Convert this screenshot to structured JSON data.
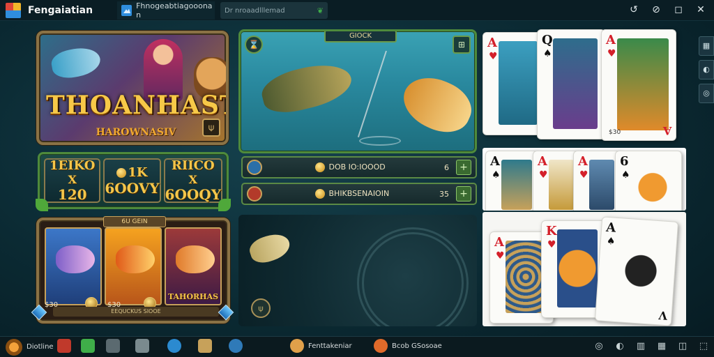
{
  "window": {
    "app_title": "Fengaiatian",
    "tab_label": "Fhnogeabtiagooona n",
    "tab_search_text": "Dr nroaadlllemad",
    "controls": [
      "↺",
      "⊘",
      "◻",
      "✕"
    ]
  },
  "banner": {
    "title": "THOANHAST",
    "subtitle": "HAROWNASIV",
    "corner_icon": "⍦"
  },
  "stats": [
    {
      "top": "1EIKO",
      "mid": "X",
      "bot": "120"
    },
    {
      "top": "1K",
      "mid": "",
      "bot": "6OOVY"
    },
    {
      "top": "RIICO",
      "mid": "X",
      "bot": "6OOQY"
    }
  ],
  "fish_cards": {
    "header": "6U GEIN",
    "cards": [
      {
        "label": ""
      },
      {
        "label": ""
      },
      {
        "label": "TAHORHAS"
      }
    ],
    "prices": [
      "$30",
      "$30"
    ],
    "footer": "EEQUCKUS SIOOE"
  },
  "scene": {
    "badge": "GIOCK",
    "btn_left": "⌛",
    "btn_right": "⊞"
  },
  "bars": [
    {
      "text": "DOB IO:IOOOD",
      "num": "6",
      "plus": "+"
    },
    {
      "text": "BHIKBSENAIOIN",
      "num": "35",
      "plus": "+"
    }
  ],
  "dark_panel": {
    "btn": "⍦"
  },
  "cards_top": [
    {
      "rank": "A",
      "suit": "♥",
      "color": "red",
      "corner": "",
      "value": ""
    },
    {
      "rank": "Q",
      "suit": "♠",
      "color": "blk",
      "corner": "",
      "value": ""
    },
    {
      "rank": "A",
      "suit": "♥",
      "color": "red",
      "corner": "A",
      "value": "$30"
    }
  ],
  "cards_mid": [
    {
      "rank": "A",
      "suit": "♠",
      "color": "blk"
    },
    {
      "rank": "A",
      "suit": "♥",
      "color": "red"
    },
    {
      "rank": "A",
      "suit": "♥",
      "color": "red"
    },
    {
      "rank": "6",
      "suit": "♠",
      "color": "blk"
    }
  ],
  "cards_bot": [
    {
      "rank": "A",
      "suit": "♥",
      "color": "red"
    },
    {
      "rank": "K",
      "suit": "♥",
      "color": "red"
    },
    {
      "rank": "A",
      "suit": "♠",
      "color": "blk",
      "corner": "V"
    }
  ],
  "rail": [
    "▦",
    "◐",
    "◎"
  ],
  "taskbar": {
    "start_label": "Diotline",
    "apps": [
      {
        "label": "Fenttakeniar"
      },
      {
        "label": "Bcob GSosoae"
      }
    ],
    "tray": [
      "◎",
      "◐",
      "▥",
      "▦",
      "◫",
      "⬚"
    ]
  }
}
